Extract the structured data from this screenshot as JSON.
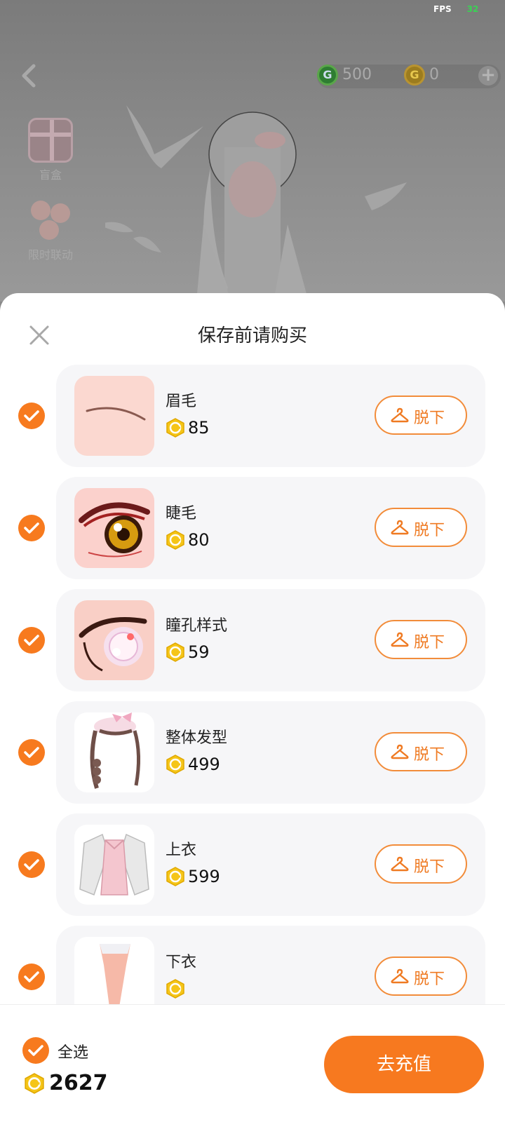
{
  "status": {
    "fps_label": "FPS",
    "fps_value": "32"
  },
  "topbar": {
    "green_currency": "500",
    "gold_currency": "0",
    "plus": "+"
  },
  "side_entries": [
    {
      "label": "盲盒",
      "icon": "gift-box-icon"
    },
    {
      "label": "限时联动",
      "icon": "flower-icon"
    }
  ],
  "sheet": {
    "title": "保存前请购买",
    "items": [
      {
        "name": "眉毛",
        "price": "85",
        "action": "脱下",
        "thumb": "eyebrow"
      },
      {
        "name": "睫毛",
        "price": "80",
        "action": "脱下",
        "thumb": "eyelash"
      },
      {
        "name": "瞳孔样式",
        "price": "59",
        "action": "脱下",
        "thumb": "pupil"
      },
      {
        "name": "整体发型",
        "price": "499",
        "action": "脱下",
        "thumb": "hairstyle"
      },
      {
        "name": "上衣",
        "price": "599",
        "action": "脱下",
        "thumb": "top"
      },
      {
        "name": "下衣",
        "price": "",
        "action": "脱下",
        "thumb": "bottom"
      }
    ]
  },
  "footer": {
    "select_all": "全选",
    "total": "2627",
    "recharge": "去充值"
  },
  "colors": {
    "accent": "#f7791f",
    "coin": "#f5c518",
    "card_bg": "#f6f6f8"
  }
}
